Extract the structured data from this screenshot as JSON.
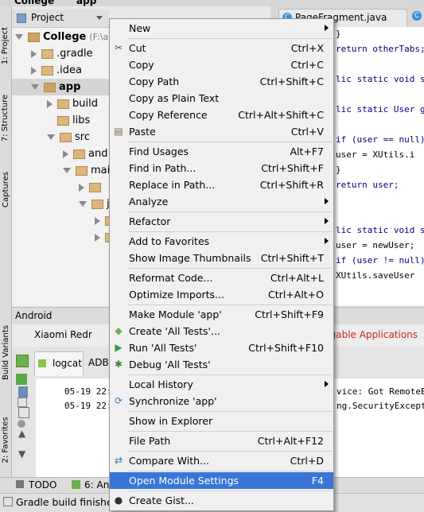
{
  "crumbs": [
    "College",
    "app"
  ],
  "left_strip": [
    "1: Project",
    "7: Structure",
    "Captures",
    "Build Variants",
    "2: Favorites"
  ],
  "project_header": {
    "title": "Project"
  },
  "tree": [
    {
      "label": "College",
      "suffix": "(F:\\ab",
      "indent": 0,
      "open": true,
      "bold": true
    },
    {
      "label": ".gradle",
      "indent": 1,
      "open": false
    },
    {
      "label": ".idea",
      "indent": 1,
      "open": false
    },
    {
      "label": "app",
      "indent": 1,
      "open": true,
      "bold": true,
      "selected": true
    },
    {
      "label": "build",
      "indent": 2,
      "open": false
    },
    {
      "label": "libs",
      "indent": 2,
      "open": null
    },
    {
      "label": "src",
      "indent": 2,
      "open": true
    },
    {
      "label": "and",
      "indent": 3,
      "open": false
    },
    {
      "label": "mai",
      "indent": 3,
      "open": true
    },
    {
      "label": "",
      "indent": 4,
      "open": false
    },
    {
      "label": "j",
      "indent": 4,
      "open": true
    },
    {
      "label": "",
      "indent": 5,
      "open": false
    },
    {
      "label": "",
      "indent": 5,
      "open": false
    }
  ],
  "editor": {
    "tab": "PageFragment.java",
    "lines": [
      {
        "text": "}",
        "y": 0
      },
      {
        "text": "return otherTabs;",
        "y": 1
      },
      {
        "text": "lic static void s",
        "y": 3
      },
      {
        "text": "lic static  User g",
        "y": 5
      },
      {
        "text": "if (user == null)",
        "y": 7
      },
      {
        "text": "    user = XUtils.i",
        "y": 8
      },
      {
        "text": "}",
        "y": 9
      },
      {
        "text": "return user;",
        "y": 10
      },
      {
        "text": "lic static void s",
        "y": 13
      },
      {
        "text": "user = newUser;",
        "y": 14
      },
      {
        "text": "if (user != null)",
        "y": 15
      },
      {
        "text": "    XUtils.saveUser",
        "y": 16
      }
    ]
  },
  "android_panel": {
    "title": "Android",
    "device": "Xiaomi Redr",
    "debuggable": "ggable Applications",
    "tabs": [
      "logcat",
      "ADB"
    ],
    "log_lines": [
      {
        "time": "05-19 22:1",
        "msg": "vice: Got RemoteEx"
      },
      {
        "time": "05-19 22:1",
        "msg": "ng.SecurityExceptio"
      }
    ]
  },
  "bottom_tabs": [
    "TODO",
    "6: And"
  ],
  "status": "Gradle build finished",
  "menu": [
    {
      "label": "New",
      "shortcut": "",
      "submenu": true
    },
    {
      "sep": true
    },
    {
      "label": "Cut",
      "shortcut": "Ctrl+X",
      "icon": "scissors-icon"
    },
    {
      "label": "Copy",
      "shortcut": "Ctrl+C"
    },
    {
      "label": "Copy Path",
      "shortcut": "Ctrl+Shift+C"
    },
    {
      "label": "Copy as Plain Text",
      "shortcut": ""
    },
    {
      "label": "Copy Reference",
      "shortcut": "Ctrl+Alt+Shift+C"
    },
    {
      "label": "Paste",
      "shortcut": "Ctrl+V",
      "icon": "clipboard-icon"
    },
    {
      "sep": true
    },
    {
      "label": "Find Usages",
      "shortcut": "Alt+F7"
    },
    {
      "label": "Find in Path...",
      "shortcut": "Ctrl+Shift+F"
    },
    {
      "label": "Replace in Path...",
      "shortcut": "Ctrl+Shift+R"
    },
    {
      "label": "Analyze",
      "shortcut": "",
      "submenu": true
    },
    {
      "sep": true
    },
    {
      "label": "Refactor",
      "shortcut": "",
      "submenu": true
    },
    {
      "sep": true
    },
    {
      "label": "Add to Favorites",
      "shortcut": "",
      "submenu": true
    },
    {
      "label": "Show Image Thumbnails",
      "shortcut": "Ctrl+Shift+T"
    },
    {
      "sep": true
    },
    {
      "label": "Reformat Code...",
      "shortcut": "Ctrl+Alt+L"
    },
    {
      "label": "Optimize Imports...",
      "shortcut": "Ctrl+Alt+O"
    },
    {
      "sep": true
    },
    {
      "label": "Make Module 'app'",
      "shortcut": "Ctrl+Shift+F9"
    },
    {
      "label": "Create 'All Tests'...",
      "shortcut": "",
      "icon": "android-test-icon"
    },
    {
      "label": "Run 'All Tests'",
      "shortcut": "Ctrl+Shift+F10",
      "icon": "run-icon"
    },
    {
      "label": "Debug 'All Tests'",
      "shortcut": "",
      "icon": "debug-icon"
    },
    {
      "sep": true
    },
    {
      "label": "Local History",
      "shortcut": "",
      "submenu": true
    },
    {
      "label": "Synchronize 'app'",
      "shortcut": "",
      "icon": "sync-icon"
    },
    {
      "sep": true
    },
    {
      "label": "Show in Explorer",
      "shortcut": ""
    },
    {
      "sep": true
    },
    {
      "label": "File Path",
      "shortcut": "Ctrl+Alt+F12"
    },
    {
      "sep": true
    },
    {
      "label": "Compare With...",
      "shortcut": "Ctrl+D",
      "icon": "compare-icon"
    },
    {
      "sep": true
    },
    {
      "label": "Open Module Settings",
      "shortcut": "F4",
      "highlighted": true
    },
    {
      "sep": true
    },
    {
      "label": "Create Gist...",
      "shortcut": "",
      "icon": "github-icon"
    }
  ],
  "colors": {
    "highlight": "#3875d7",
    "menu_bg": "#f0f0f0",
    "keyword": "#000080"
  }
}
